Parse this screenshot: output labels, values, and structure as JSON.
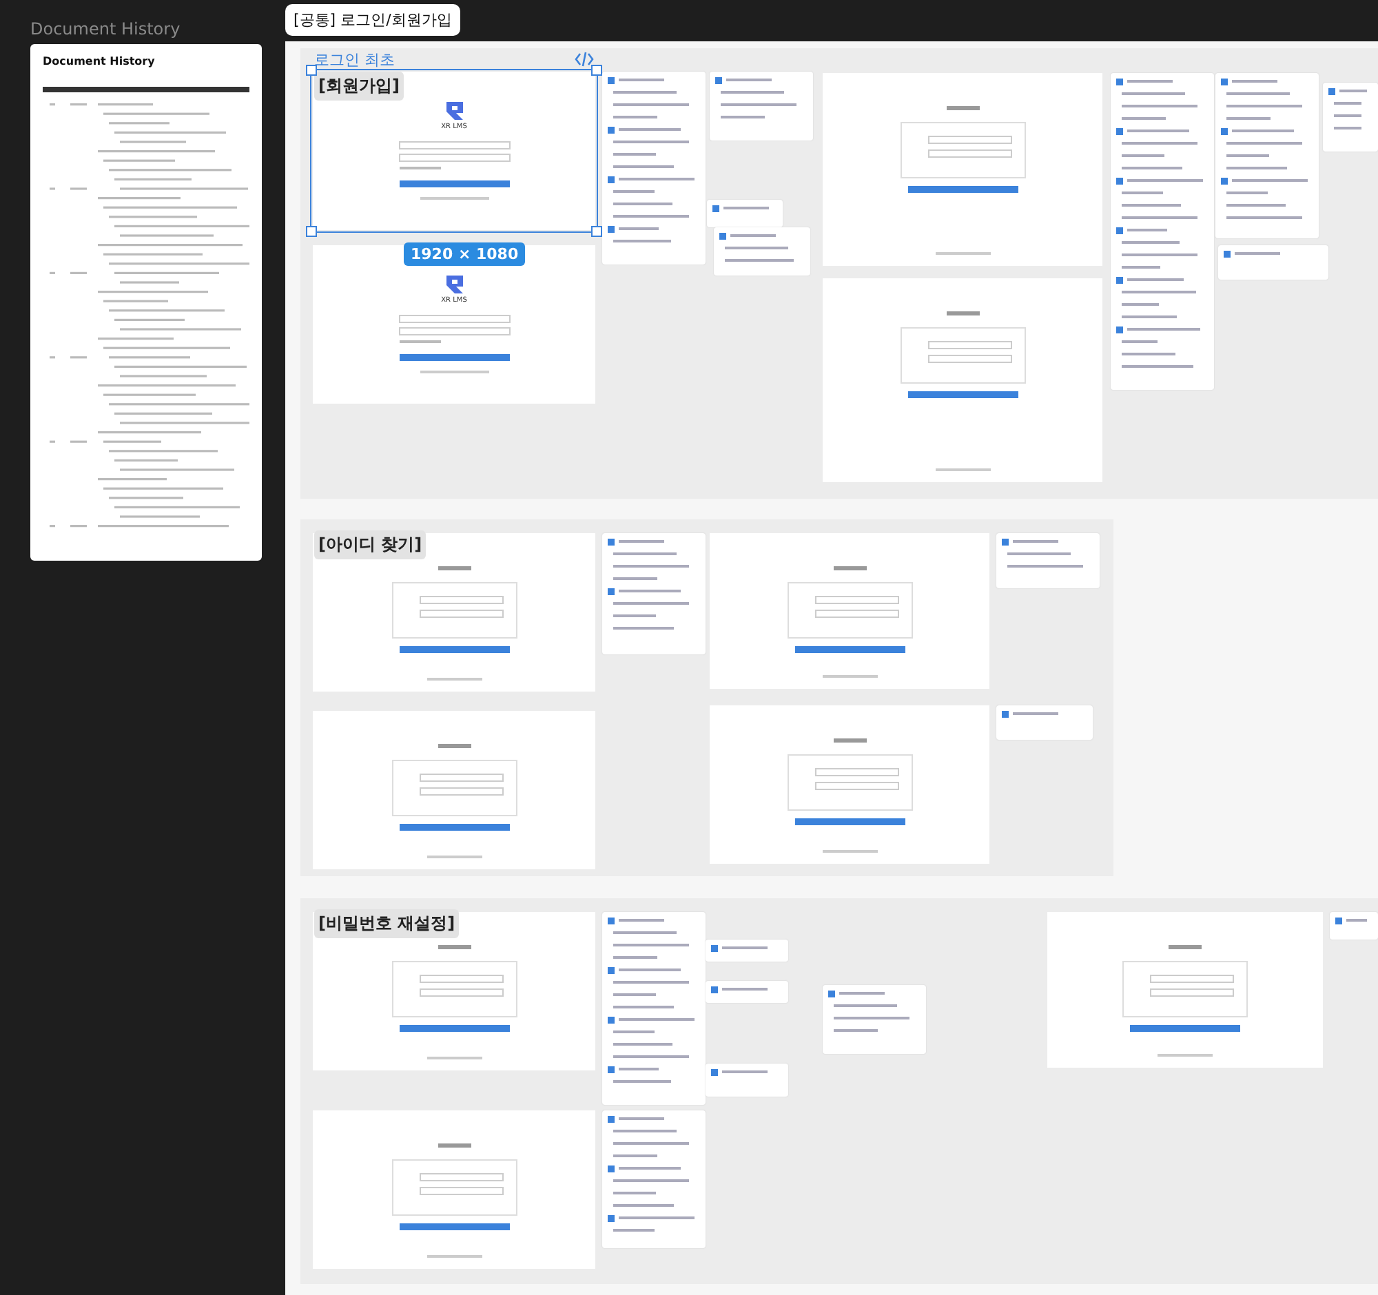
{
  "sidebar": {
    "label": "Document History",
    "document": {
      "title": "Document History"
    }
  },
  "page": {
    "title": "[공통] 로그인/회원가입"
  },
  "sections": [
    {
      "title": "[회원가입]",
      "caption": "로그인 최초",
      "frame_selected": true,
      "frame_size": "1920 × 1080",
      "logos": [
        "XR LMS",
        "XR LMS"
      ]
    },
    {
      "title": "[아이디 찾기]",
      "frame_selected": false
    },
    {
      "title": "[비밀번호 재설정]",
      "frame_selected": false
    }
  ]
}
